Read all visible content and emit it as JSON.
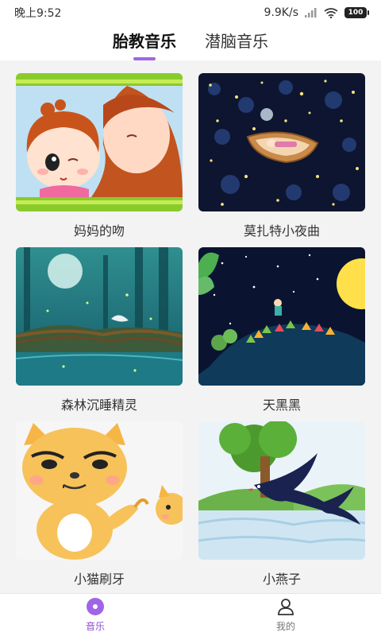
{
  "status_bar": {
    "time": "晚上9:52",
    "network_speed": "9.9K/s",
    "battery": "100"
  },
  "tabs": [
    {
      "label": "胎教音乐",
      "active": true
    },
    {
      "label": "潜脑音乐",
      "active": false
    }
  ],
  "cards": [
    {
      "title": "妈妈的吻",
      "image": "mother-kiss-cartoon"
    },
    {
      "title": "莫扎特小夜曲",
      "image": "night-boat-illustration"
    },
    {
      "title": "森林沉睡精灵",
      "image": "forest-fairy-illustration"
    },
    {
      "title": "天黑黑",
      "image": "night-bridge-illustration"
    },
    {
      "title": "小猫刷牙",
      "image": "cartoon-cat"
    },
    {
      "title": "小燕子",
      "image": "swallows-illustration"
    }
  ],
  "bottom_nav": [
    {
      "label": "音乐",
      "icon": "music-disc-icon",
      "active": true
    },
    {
      "label": "我的",
      "icon": "user-icon",
      "active": false
    }
  ],
  "colors": {
    "accent": "#a065e6",
    "nav_active": "#8d4fd6"
  }
}
